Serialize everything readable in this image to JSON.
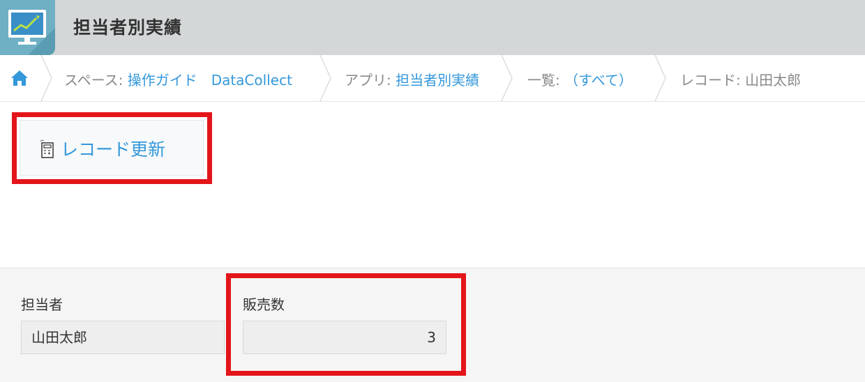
{
  "app": {
    "title": "担当者別実績"
  },
  "breadcrumb": {
    "space_prefix": "スペース: ",
    "space_name": "操作ガイド　DataCollect",
    "app_prefix": "アプリ: ",
    "app_name": "担当者別実績",
    "view_prefix": "一覧: ",
    "view_name": "（すべて）",
    "record_prefix": "レコード: ",
    "record_name": "山田太郎"
  },
  "toolbar": {
    "record_update_label": "レコード更新"
  },
  "record": {
    "fields": [
      {
        "label": "担当者",
        "value": "山田太郎"
      },
      {
        "label": "販売数",
        "value": "3"
      }
    ]
  },
  "colors": {
    "accent": "#3498db",
    "highlight": "#e3151a",
    "header_bg": "#d4d7d8"
  }
}
